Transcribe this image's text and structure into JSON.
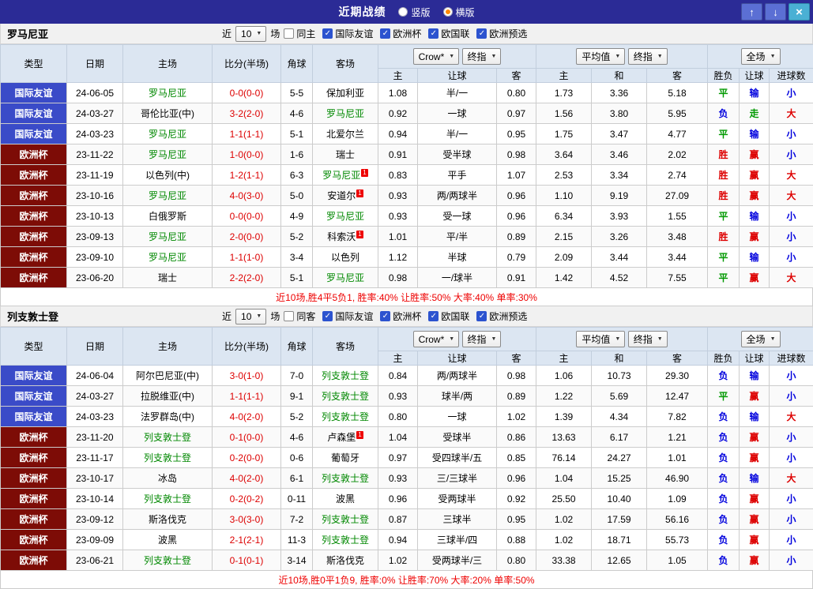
{
  "colors": {
    "red": "#dd0000",
    "green": "#009900",
    "blue": "#0000dd",
    "type_friendly": "#3a4bc8",
    "type_euro": "#7d0c06",
    "team_green": "#008800",
    "score_red": "#dd0000",
    "summary_red": "#ee0000",
    "titlebar_bg": "#2b2b96",
    "header_bg": "#dce6f2"
  },
  "icons": {
    "chevron_down": "▼",
    "check": "✓",
    "up": "↑",
    "down": "↓",
    "close": "×"
  },
  "titlebar": {
    "title": "近期战绩",
    "radios": [
      {
        "label": "竖版",
        "dot": "#ffffff"
      },
      {
        "label": "横版",
        "dot": "#ff8800"
      }
    ]
  },
  "filter_labels": {
    "near": "近",
    "count": "10",
    "matches": "场",
    "leagues": [
      "国际友谊",
      "欧洲杯",
      "欧国联",
      "欧洲预选"
    ]
  },
  "columns": {
    "type": "类型",
    "date": "日期",
    "home": "主场",
    "score": "比分(半场)",
    "corner": "角球",
    "away": "客场",
    "asia_selects": [
      "Crow*",
      "终指"
    ],
    "euro_selects": [
      "平均值",
      "终指"
    ],
    "scope_select": "全场",
    "asia_home": "主",
    "asia_hcap": "让球",
    "asia_away": "客",
    "euro_home": "主",
    "euro_draw": "和",
    "euro_away": "客",
    "result_wdl": "胜负",
    "result_hcap": "让球",
    "result_goals": "进球数"
  },
  "sections": [
    {
      "team": "罗马尼亚",
      "same_label": "同主",
      "summary": "近10场,胜4平5负1, 胜率:40% 让胜率:50% 大率:40% 单率:30%",
      "rows": [
        {
          "type": "国际友谊",
          "type_key": "friendly",
          "date": "24-06-05",
          "home": "罗马尼亚",
          "home_green": true,
          "home_sup": "",
          "score": "0-0(0-0)",
          "corner": "5-5",
          "away": "保加利亚",
          "away_green": false,
          "away_sup": "",
          "asia": [
            "1.08",
            "半/一",
            "0.80"
          ],
          "euro": [
            "1.73",
            "3.36",
            "5.18"
          ],
          "results": [
            {
              "t": "平",
              "c": "green"
            },
            {
              "t": "输",
              "c": "blue"
            },
            {
              "t": "小",
              "c": "blue"
            }
          ]
        },
        {
          "type": "国际友谊",
          "type_key": "friendly",
          "date": "24-03-27",
          "home": "哥伦比亚(中)",
          "home_green": false,
          "home_sup": "",
          "score": "3-2(2-0)",
          "corner": "4-6",
          "away": "罗马尼亚",
          "away_green": true,
          "away_sup": "",
          "asia": [
            "0.92",
            "一球",
            "0.97"
          ],
          "euro": [
            "1.56",
            "3.80",
            "5.95"
          ],
          "results": [
            {
              "t": "负",
              "c": "blue"
            },
            {
              "t": "走",
              "c": "green"
            },
            {
              "t": "大",
              "c": "red"
            }
          ]
        },
        {
          "type": "国际友谊",
          "type_key": "friendly",
          "date": "24-03-23",
          "home": "罗马尼亚",
          "home_green": true,
          "home_sup": "",
          "score": "1-1(1-1)",
          "corner": "5-1",
          "away": "北爱尔兰",
          "away_green": false,
          "away_sup": "",
          "asia": [
            "0.94",
            "半/一",
            "0.95"
          ],
          "euro": [
            "1.75",
            "3.47",
            "4.77"
          ],
          "results": [
            {
              "t": "平",
              "c": "green"
            },
            {
              "t": "输",
              "c": "blue"
            },
            {
              "t": "小",
              "c": "blue"
            }
          ]
        },
        {
          "type": "欧洲杯",
          "type_key": "euro",
          "date": "23-11-22",
          "home": "罗马尼亚",
          "home_green": true,
          "home_sup": "",
          "score": "1-0(0-0)",
          "corner": "1-6",
          "away": "瑞士",
          "away_green": false,
          "away_sup": "",
          "asia": [
            "0.91",
            "受半球",
            "0.98"
          ],
          "euro": [
            "3.64",
            "3.46",
            "2.02"
          ],
          "results": [
            {
              "t": "胜",
              "c": "red"
            },
            {
              "t": "赢",
              "c": "red"
            },
            {
              "t": "小",
              "c": "blue"
            }
          ]
        },
        {
          "type": "欧洲杯",
          "type_key": "euro",
          "date": "23-11-19",
          "home": "以色列(中)",
          "home_green": false,
          "home_sup": "",
          "score": "1-2(1-1)",
          "corner": "6-3",
          "away": "罗马尼亚",
          "away_green": true,
          "away_sup": "1",
          "asia": [
            "0.83",
            "平手",
            "1.07"
          ],
          "euro": [
            "2.53",
            "3.34",
            "2.74"
          ],
          "results": [
            {
              "t": "胜",
              "c": "red"
            },
            {
              "t": "赢",
              "c": "red"
            },
            {
              "t": "大",
              "c": "red"
            }
          ]
        },
        {
          "type": "欧洲杯",
          "type_key": "euro",
          "date": "23-10-16",
          "home": "罗马尼亚",
          "home_green": true,
          "home_sup": "",
          "score": "4-0(3-0)",
          "corner": "5-0",
          "away": "安道尔",
          "away_green": false,
          "away_sup": "1",
          "asia": [
            "0.93",
            "两/两球半",
            "0.96"
          ],
          "euro": [
            "1.10",
            "9.19",
            "27.09"
          ],
          "results": [
            {
              "t": "胜",
              "c": "red"
            },
            {
              "t": "赢",
              "c": "red"
            },
            {
              "t": "大",
              "c": "red"
            }
          ]
        },
        {
          "type": "欧洲杯",
          "type_key": "euro",
          "date": "23-10-13",
          "home": "白俄罗斯",
          "home_green": false,
          "home_sup": "",
          "score": "0-0(0-0)",
          "corner": "4-9",
          "away": "罗马尼亚",
          "away_green": true,
          "away_sup": "",
          "asia": [
            "0.93",
            "受一球",
            "0.96"
          ],
          "euro": [
            "6.34",
            "3.93",
            "1.55"
          ],
          "results": [
            {
              "t": "平",
              "c": "green"
            },
            {
              "t": "输",
              "c": "blue"
            },
            {
              "t": "小",
              "c": "blue"
            }
          ]
        },
        {
          "type": "欧洲杯",
          "type_key": "euro",
          "date": "23-09-13",
          "home": "罗马尼亚",
          "home_green": true,
          "home_sup": "",
          "score": "2-0(0-0)",
          "corner": "5-2",
          "away": "科索沃",
          "away_green": false,
          "away_sup": "1",
          "asia": [
            "1.01",
            "平/半",
            "0.89"
          ],
          "euro": [
            "2.15",
            "3.26",
            "3.48"
          ],
          "results": [
            {
              "t": "胜",
              "c": "red"
            },
            {
              "t": "赢",
              "c": "red"
            },
            {
              "t": "小",
              "c": "blue"
            }
          ]
        },
        {
          "type": "欧洲杯",
          "type_key": "euro",
          "date": "23-09-10",
          "home": "罗马尼亚",
          "home_green": true,
          "home_sup": "",
          "score": "1-1(1-0)",
          "corner": "3-4",
          "away": "以色列",
          "away_green": false,
          "away_sup": "",
          "asia": [
            "1.12",
            "半球",
            "0.79"
          ],
          "euro": [
            "2.09",
            "3.44",
            "3.44"
          ],
          "results": [
            {
              "t": "平",
              "c": "green"
            },
            {
              "t": "输",
              "c": "blue"
            },
            {
              "t": "小",
              "c": "blue"
            }
          ]
        },
        {
          "type": "欧洲杯",
          "type_key": "euro",
          "date": "23-06-20",
          "home": "瑞士",
          "home_green": false,
          "home_sup": "",
          "score": "2-2(2-0)",
          "corner": "5-1",
          "away": "罗马尼亚",
          "away_green": true,
          "away_sup": "",
          "asia": [
            "0.98",
            "一/球半",
            "0.91"
          ],
          "euro": [
            "1.42",
            "4.52",
            "7.55"
          ],
          "results": [
            {
              "t": "平",
              "c": "green"
            },
            {
              "t": "赢",
              "c": "red"
            },
            {
              "t": "大",
              "c": "red"
            }
          ]
        }
      ]
    },
    {
      "team": "列支敦士登",
      "same_label": "同客",
      "summary": "近10场,胜0平1负9, 胜率:0% 让胜率:70% 大率:20% 单率:50%",
      "rows": [
        {
          "type": "国际友谊",
          "type_key": "friendly",
          "date": "24-06-04",
          "home": "阿尔巴尼亚(中)",
          "home_green": false,
          "home_sup": "",
          "score": "3-0(1-0)",
          "corner": "7-0",
          "away": "列支敦士登",
          "away_green": true,
          "away_sup": "",
          "asia": [
            "0.84",
            "两/两球半",
            "0.98"
          ],
          "euro": [
            "1.06",
            "10.73",
            "29.30"
          ],
          "results": [
            {
              "t": "负",
              "c": "blue"
            },
            {
              "t": "输",
              "c": "blue"
            },
            {
              "t": "小",
              "c": "blue"
            }
          ]
        },
        {
          "type": "国际友谊",
          "type_key": "friendly",
          "date": "24-03-27",
          "home": "拉脱维亚(中)",
          "home_green": false,
          "home_sup": "",
          "score": "1-1(1-1)",
          "corner": "9-1",
          "away": "列支敦士登",
          "away_green": true,
          "away_sup": "",
          "asia": [
            "0.93",
            "球半/两",
            "0.89"
          ],
          "euro": [
            "1.22",
            "5.69",
            "12.47"
          ],
          "results": [
            {
              "t": "平",
              "c": "green"
            },
            {
              "t": "赢",
              "c": "red"
            },
            {
              "t": "小",
              "c": "blue"
            }
          ]
        },
        {
          "type": "国际友谊",
          "type_key": "friendly",
          "date": "24-03-23",
          "home": "法罗群岛(中)",
          "home_green": false,
          "home_sup": "",
          "score": "4-0(2-0)",
          "corner": "5-2",
          "away": "列支敦士登",
          "away_green": true,
          "away_sup": "",
          "asia": [
            "0.80",
            "一球",
            "1.02"
          ],
          "euro": [
            "1.39",
            "4.34",
            "7.82"
          ],
          "results": [
            {
              "t": "负",
              "c": "blue"
            },
            {
              "t": "输",
              "c": "blue"
            },
            {
              "t": "大",
              "c": "red"
            }
          ]
        },
        {
          "type": "欧洲杯",
          "type_key": "euro",
          "date": "23-11-20",
          "home": "列支敦士登",
          "home_green": true,
          "home_sup": "",
          "score": "0-1(0-0)",
          "corner": "4-6",
          "away": "卢森堡",
          "away_green": false,
          "away_sup": "1",
          "asia": [
            "1.04",
            "受球半",
            "0.86"
          ],
          "euro": [
            "13.63",
            "6.17",
            "1.21"
          ],
          "results": [
            {
              "t": "负",
              "c": "blue"
            },
            {
              "t": "赢",
              "c": "red"
            },
            {
              "t": "小",
              "c": "blue"
            }
          ]
        },
        {
          "type": "欧洲杯",
          "type_key": "euro",
          "date": "23-11-17",
          "home": "列支敦士登",
          "home_green": true,
          "home_sup": "",
          "score": "0-2(0-0)",
          "corner": "0-6",
          "away": "葡萄牙",
          "away_green": false,
          "away_sup": "",
          "asia": [
            "0.97",
            "受四球半/五",
            "0.85"
          ],
          "euro": [
            "76.14",
            "24.27",
            "1.01"
          ],
          "results": [
            {
              "t": "负",
              "c": "blue"
            },
            {
              "t": "赢",
              "c": "red"
            },
            {
              "t": "小",
              "c": "blue"
            }
          ]
        },
        {
          "type": "欧洲杯",
          "type_key": "euro",
          "date": "23-10-17",
          "home": "冰岛",
          "home_green": false,
          "home_sup": "",
          "score": "4-0(2-0)",
          "corner": "6-1",
          "away": "列支敦士登",
          "away_green": true,
          "away_sup": "",
          "asia": [
            "0.93",
            "三/三球半",
            "0.96"
          ],
          "euro": [
            "1.04",
            "15.25",
            "46.90"
          ],
          "results": [
            {
              "t": "负",
              "c": "blue"
            },
            {
              "t": "输",
              "c": "blue"
            },
            {
              "t": "大",
              "c": "red"
            }
          ]
        },
        {
          "type": "欧洲杯",
          "type_key": "euro",
          "date": "23-10-14",
          "home": "列支敦士登",
          "home_green": true,
          "home_sup": "",
          "score": "0-2(0-2)",
          "corner": "0-11",
          "away": "波黑",
          "away_green": false,
          "away_sup": "",
          "asia": [
            "0.96",
            "受两球半",
            "0.92"
          ],
          "euro": [
            "25.50",
            "10.40",
            "1.09"
          ],
          "results": [
            {
              "t": "负",
              "c": "blue"
            },
            {
              "t": "赢",
              "c": "red"
            },
            {
              "t": "小",
              "c": "blue"
            }
          ]
        },
        {
          "type": "欧洲杯",
          "type_key": "euro",
          "date": "23-09-12",
          "home": "斯洛伐克",
          "home_green": false,
          "home_sup": "",
          "score": "3-0(3-0)",
          "corner": "7-2",
          "away": "列支敦士登",
          "away_green": true,
          "away_sup": "",
          "asia": [
            "0.87",
            "三球半",
            "0.95"
          ],
          "euro": [
            "1.02",
            "17.59",
            "56.16"
          ],
          "results": [
            {
              "t": "负",
              "c": "blue"
            },
            {
              "t": "赢",
              "c": "red"
            },
            {
              "t": "小",
              "c": "blue"
            }
          ]
        },
        {
          "type": "欧洲杯",
          "type_key": "euro",
          "date": "23-09-09",
          "home": "波黑",
          "home_green": false,
          "home_sup": "",
          "score": "2-1(2-1)",
          "corner": "11-3",
          "away": "列支敦士登",
          "away_green": true,
          "away_sup": "",
          "asia": [
            "0.94",
            "三球半/四",
            "0.88"
          ],
          "euro": [
            "1.02",
            "18.71",
            "55.73"
          ],
          "results": [
            {
              "t": "负",
              "c": "blue"
            },
            {
              "t": "赢",
              "c": "red"
            },
            {
              "t": "小",
              "c": "blue"
            }
          ]
        },
        {
          "type": "欧洲杯",
          "type_key": "euro",
          "date": "23-06-21",
          "home": "列支敦士登",
          "home_green": true,
          "home_sup": "",
          "score": "0-1(0-1)",
          "corner": "3-14",
          "away": "斯洛伐克",
          "away_green": false,
          "away_sup": "",
          "asia": [
            "1.02",
            "受两球半/三",
            "0.80"
          ],
          "euro": [
            "33.38",
            "12.65",
            "1.05"
          ],
          "results": [
            {
              "t": "负",
              "c": "blue"
            },
            {
              "t": "赢",
              "c": "red"
            },
            {
              "t": "小",
              "c": "blue"
            }
          ]
        }
      ]
    }
  ]
}
